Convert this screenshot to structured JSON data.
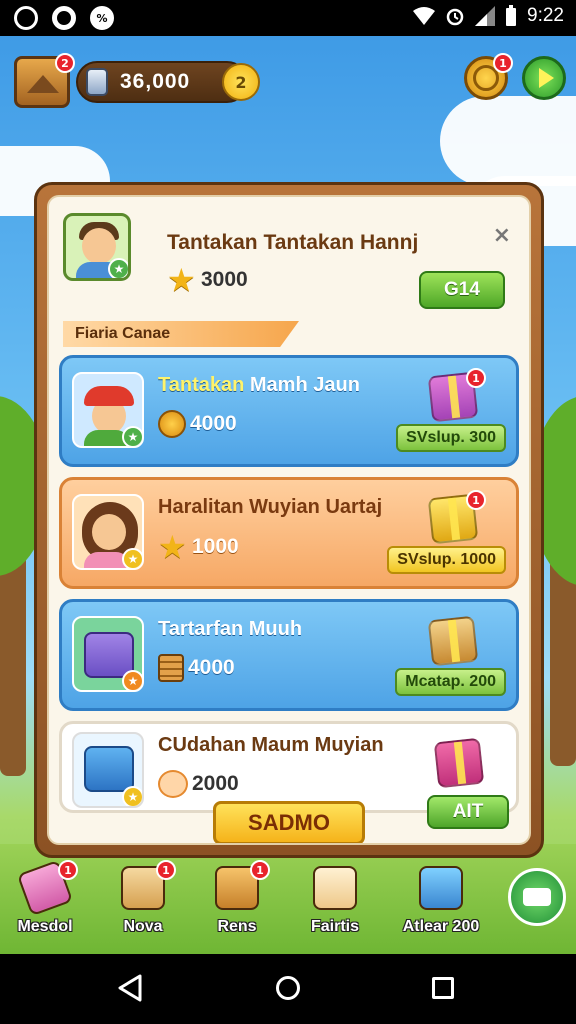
{
  "status_bar": {
    "time": "9:22"
  },
  "topbar": {
    "map_badge": "2",
    "currency_value": "36,000",
    "coin_label": "2",
    "spin_badge": "1"
  },
  "panel": {
    "header": {
      "title": "Tantakan Tantakan Hannj",
      "reward": "3000",
      "button_label": "G14",
      "close_label": "×"
    },
    "section_label": "Fiaria Canae",
    "rows": [
      {
        "title_highlight": "Tantakan",
        "title_rest": " Mamh Jaun",
        "reward": "4000",
        "button": "SVslup. 300",
        "badge": "1"
      },
      {
        "title": "Haralitan Wuyian Uartaj",
        "reward": "1000",
        "button": "SVslup. 1000",
        "badge": "1"
      },
      {
        "title": "Tartarfan Muuh",
        "reward": "4000",
        "button": "Mcatap. 200"
      },
      {
        "title": "CUdahan Maum Muyian",
        "reward": "2000"
      }
    ],
    "primary_button": "SADMO",
    "secondary_button": "AIT"
  },
  "dock": {
    "items": [
      {
        "label": "Mesdol",
        "badge": "1"
      },
      {
        "label": "Nova",
        "badge": "1"
      },
      {
        "label": "Rens",
        "badge": "1"
      },
      {
        "label": "Fairtis"
      },
      {
        "label": "Atlear 200"
      }
    ]
  }
}
